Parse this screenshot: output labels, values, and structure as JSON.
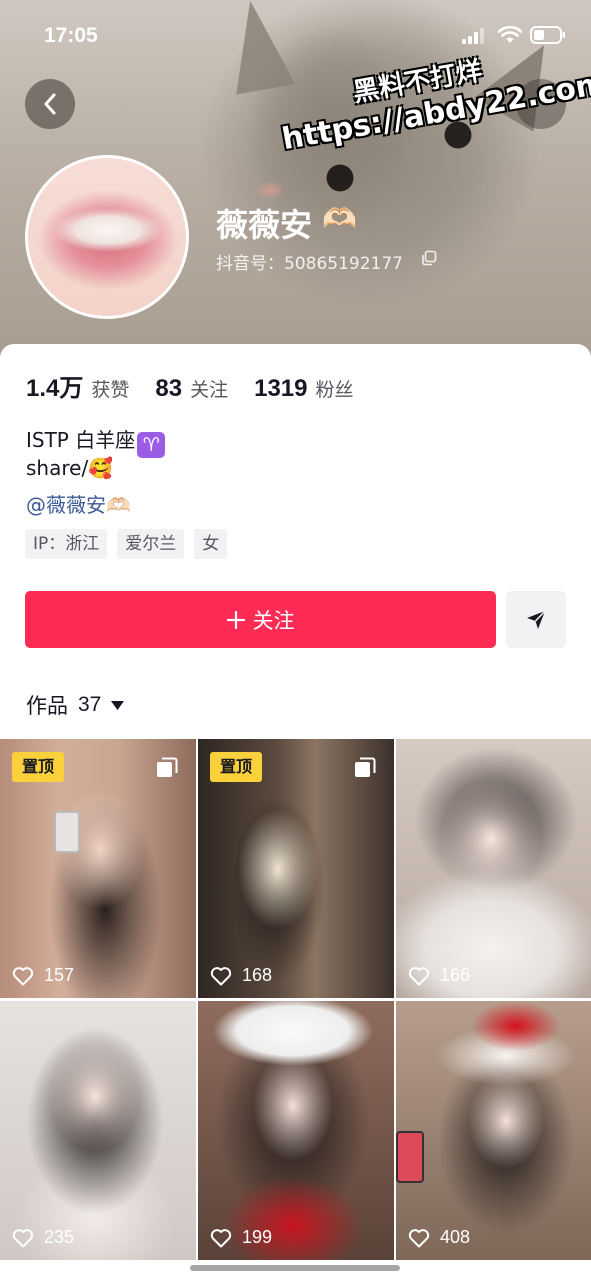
{
  "status_bar": {
    "time": "17:05"
  },
  "watermark": {
    "line1": "黑料不打烊",
    "line2": "https://abdy22.com"
  },
  "profile": {
    "nickname": "薇薇安",
    "nickname_emoji": "🫶🏻",
    "douyin_id": "抖音号：50865192177",
    "stats": [
      {
        "value": "1.4万",
        "label": "获赞"
      },
      {
        "value": "83",
        "label": "关注"
      },
      {
        "value": "1319",
        "label": "粉丝"
      }
    ],
    "bio": {
      "line1": "ISTP 白羊座",
      "line1_badge": "♈",
      "line2": "share/🥰",
      "line3": "@薇薇安🫶🏻"
    },
    "tags": [
      "IP：浙江",
      "爱尔兰",
      "女"
    ]
  },
  "actions": {
    "follow_label": "关注"
  },
  "works": {
    "label": "作品",
    "count": "37",
    "items": [
      {
        "pinned": "置顶",
        "likes": "157"
      },
      {
        "pinned": "置顶",
        "likes": "168"
      },
      {
        "pinned": "",
        "likes": "166"
      },
      {
        "pinned": "",
        "likes": "235"
      },
      {
        "pinned": "",
        "likes": "199"
      },
      {
        "pinned": "",
        "likes": "408"
      }
    ]
  },
  "colors": {
    "accent": "#fe2c55",
    "pin_badge": "#fad03b",
    "mention": "#3c5a96"
  }
}
